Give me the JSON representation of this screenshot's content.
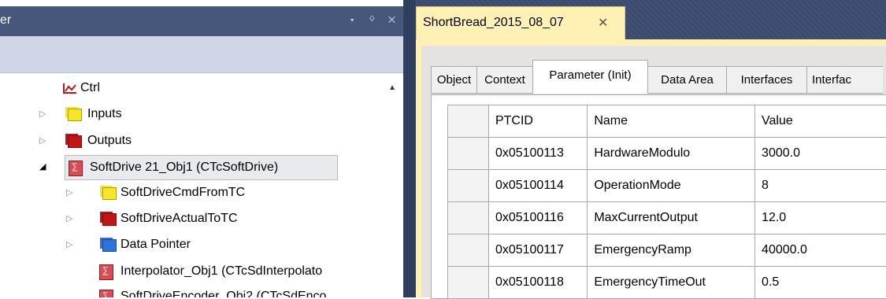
{
  "left_panel": {
    "title": "er",
    "title_buttons": "▾ ᛜ ✕",
    "tree": [
      {
        "label": "Ctrl",
        "icon": "ctrl-icon"
      },
      {
        "label": "Inputs",
        "icon": "inputs-folder-icon",
        "color": "#f5e628"
      },
      {
        "label": "Outputs",
        "icon": "outputs-folder-icon",
        "color": "#c01616"
      },
      {
        "label": "SoftDrive 21_Obj1 (CTcSoftDrive)",
        "icon": "tcom-object-icon"
      },
      {
        "label": "SoftDriveCmdFromTC",
        "icon": "input-image-icon",
        "color": "#f5e628"
      },
      {
        "label": "SoftDriveActualToTC",
        "icon": "output-image-icon",
        "color": "#c01616"
      },
      {
        "label": "Data Pointer",
        "icon": "data-pointer-icon",
        "color": "#2d74d8"
      },
      {
        "label": "Interpolator_Obj1 (CTcSdInterpolato",
        "icon": "tcom-object-icon"
      },
      {
        "label": "SoftDriveEncoder_Obj2 (CTcSdEnco",
        "icon": "tcom-object-icon"
      }
    ]
  },
  "right_panel": {
    "doc_tab": {
      "label": "ShortBread_2015_08_07",
      "close": "✕"
    },
    "tabs": [
      "Object",
      "Context",
      "Parameter (Init)",
      "Data Area",
      "Interfaces",
      "Interfac"
    ],
    "active_tab": "Parameter (Init)",
    "table": {
      "headers": [
        "PTCID",
        "Name",
        "Value"
      ],
      "rows": [
        [
          "0x05100113",
          "HardwareModulo",
          "3000.0"
        ],
        [
          "0x05100114",
          "OperationMode",
          "8"
        ],
        [
          "0x05100116",
          "MaxCurrentOutput",
          "12.0"
        ],
        [
          "0x05100117",
          "EmergencyRamp",
          "40000.0"
        ],
        [
          "0x05100118",
          "EmergencyTimeOut",
          "0.5"
        ]
      ]
    }
  },
  "colors": {
    "title_bar": "#47577c",
    "toolbar": "#cfd6e5",
    "doc_tab_bg": "#fff1b4",
    "divider": "#2c3b5c"
  }
}
